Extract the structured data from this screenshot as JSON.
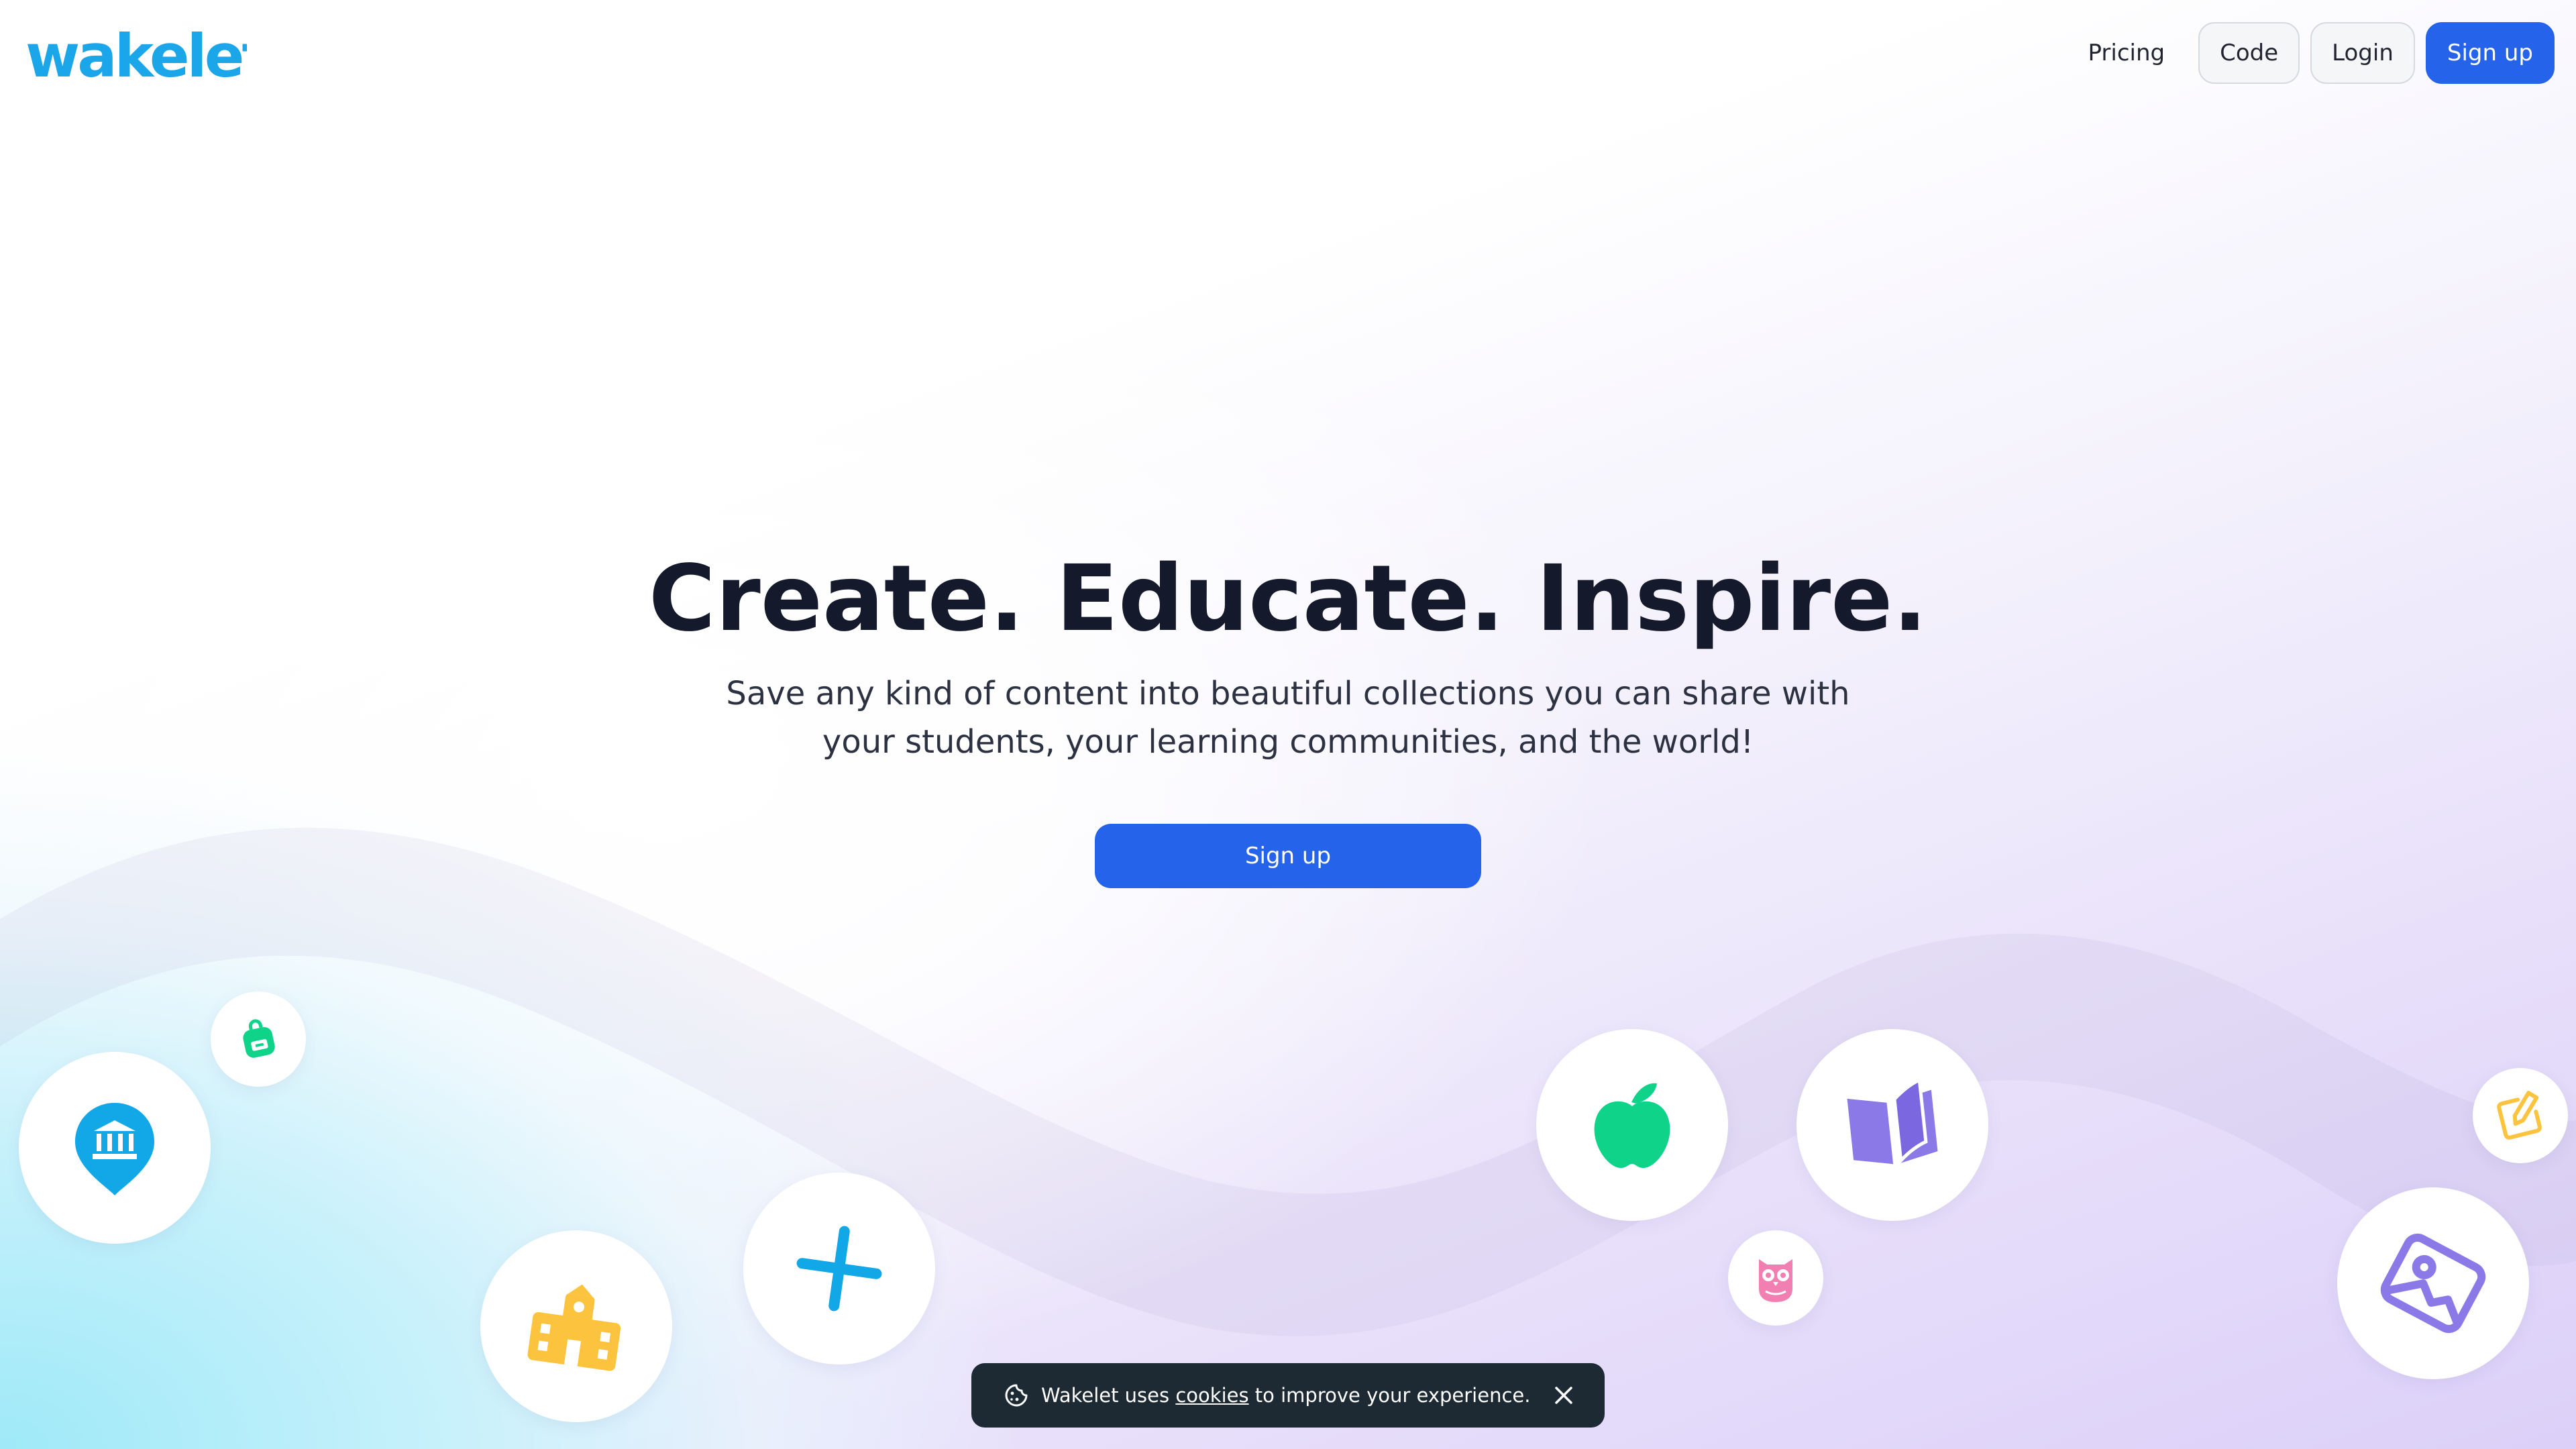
{
  "brand": {
    "logo_text": "wakelet",
    "logo_color": "#1aa6e8"
  },
  "nav": {
    "pricing_label": "Pricing",
    "code_label": "Code",
    "login_label": "Login",
    "signup_label": "Sign up"
  },
  "hero": {
    "title": "Create. Educate. Inspire.",
    "subtitle": "Save any kind of content into beautiful collections you can share with your students, your learning communities, and the world!",
    "cta_label": "Sign up"
  },
  "cookie_banner": {
    "text_before": "Wakelet uses ",
    "link_label": "cookies",
    "text_after": " to improve your experience."
  },
  "icons": [
    "backpack-icon",
    "museum-pin-icon",
    "school-icon",
    "plus-icon",
    "apple-icon",
    "book-icon",
    "owl-icon",
    "edit-icon",
    "image-icon"
  ],
  "colors": {
    "primary": "#2563eb",
    "heading": "#141a2b",
    "cookie_bg": "#1d2a33",
    "green": "#10d38a",
    "blue": "#12a8e8",
    "yellow": "#fcc43e",
    "purple": "#8b79e8",
    "pink": "#f27fb2"
  }
}
